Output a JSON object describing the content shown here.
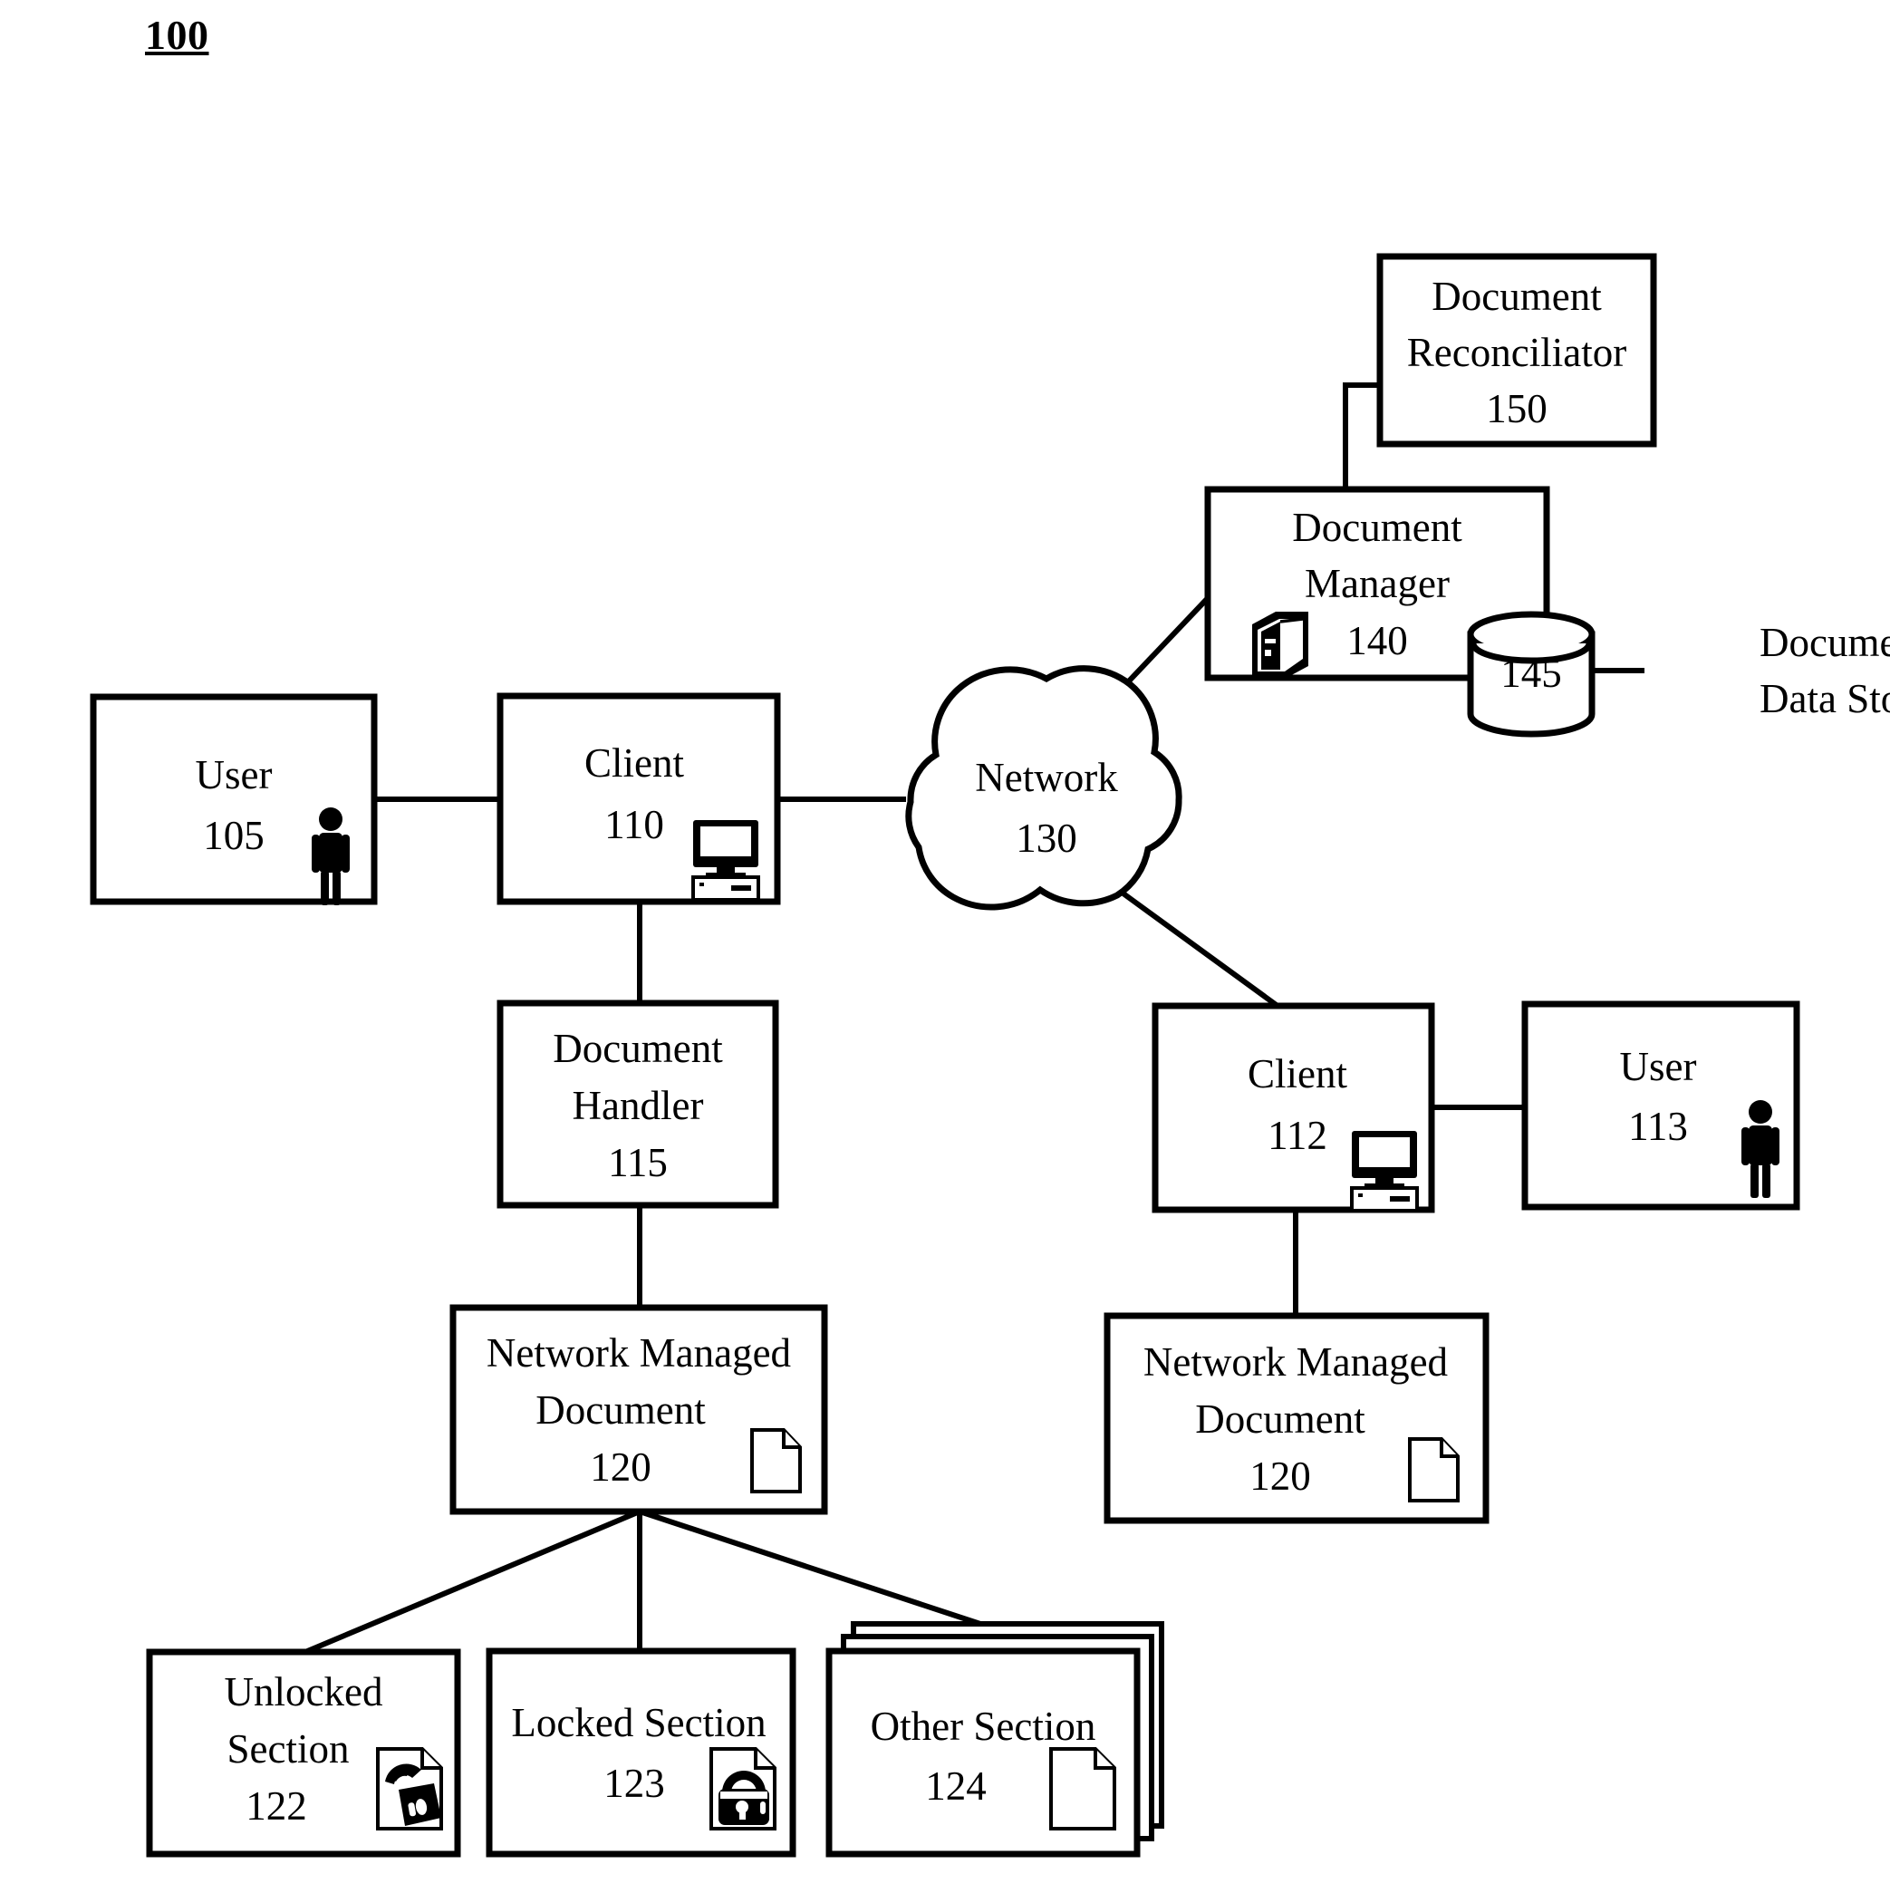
{
  "figure": {
    "number": "100"
  },
  "nodes": {
    "user105": {
      "line1": "User",
      "line2": "105",
      "icon": "person-icon"
    },
    "client110": {
      "line1": "Client",
      "line2": "110",
      "icon": "computer-icon"
    },
    "network130": {
      "line1": "Network",
      "line2": "130"
    },
    "document_manager140": {
      "line1": "Document",
      "line2": "Manager",
      "line3": "140",
      "icon": "server-icon"
    },
    "document_reconciliator150": {
      "line1": "Document",
      "line2": "Reconciliator",
      "line3": "150"
    },
    "datastore145": {
      "label": "145",
      "caption_line1": "Document",
      "caption_line2": "Data Store",
      "icon": "database-cylinder-icon"
    },
    "document_handler115": {
      "line1": "Document",
      "line2": "Handler",
      "line3": "115"
    },
    "nmd120_left": {
      "line1": "Network Managed",
      "line2": "Document",
      "line3": "120",
      "icon": "document-icon"
    },
    "nmd120_right": {
      "line1": "Network Managed",
      "line2": "Document",
      "line3": "120",
      "icon": "document-icon"
    },
    "client112": {
      "line1": "Client",
      "line2": "112",
      "icon": "computer-icon"
    },
    "user113": {
      "line1": "User",
      "line2": "113",
      "icon": "person-icon"
    },
    "unlocked_section122": {
      "line1": "Unlocked",
      "line2": "Section",
      "line3": "122",
      "icon": "document-unlocked-padlock-icon"
    },
    "locked_section123": {
      "line1": "Locked Section",
      "line2": "123",
      "icon": "document-locked-padlock-icon"
    },
    "other_section124": {
      "line1": "Other Section",
      "line2": "124",
      "icon": "document-icon"
    }
  },
  "colors": {
    "stroke": "#000000",
    "fill": "#ffffff"
  }
}
